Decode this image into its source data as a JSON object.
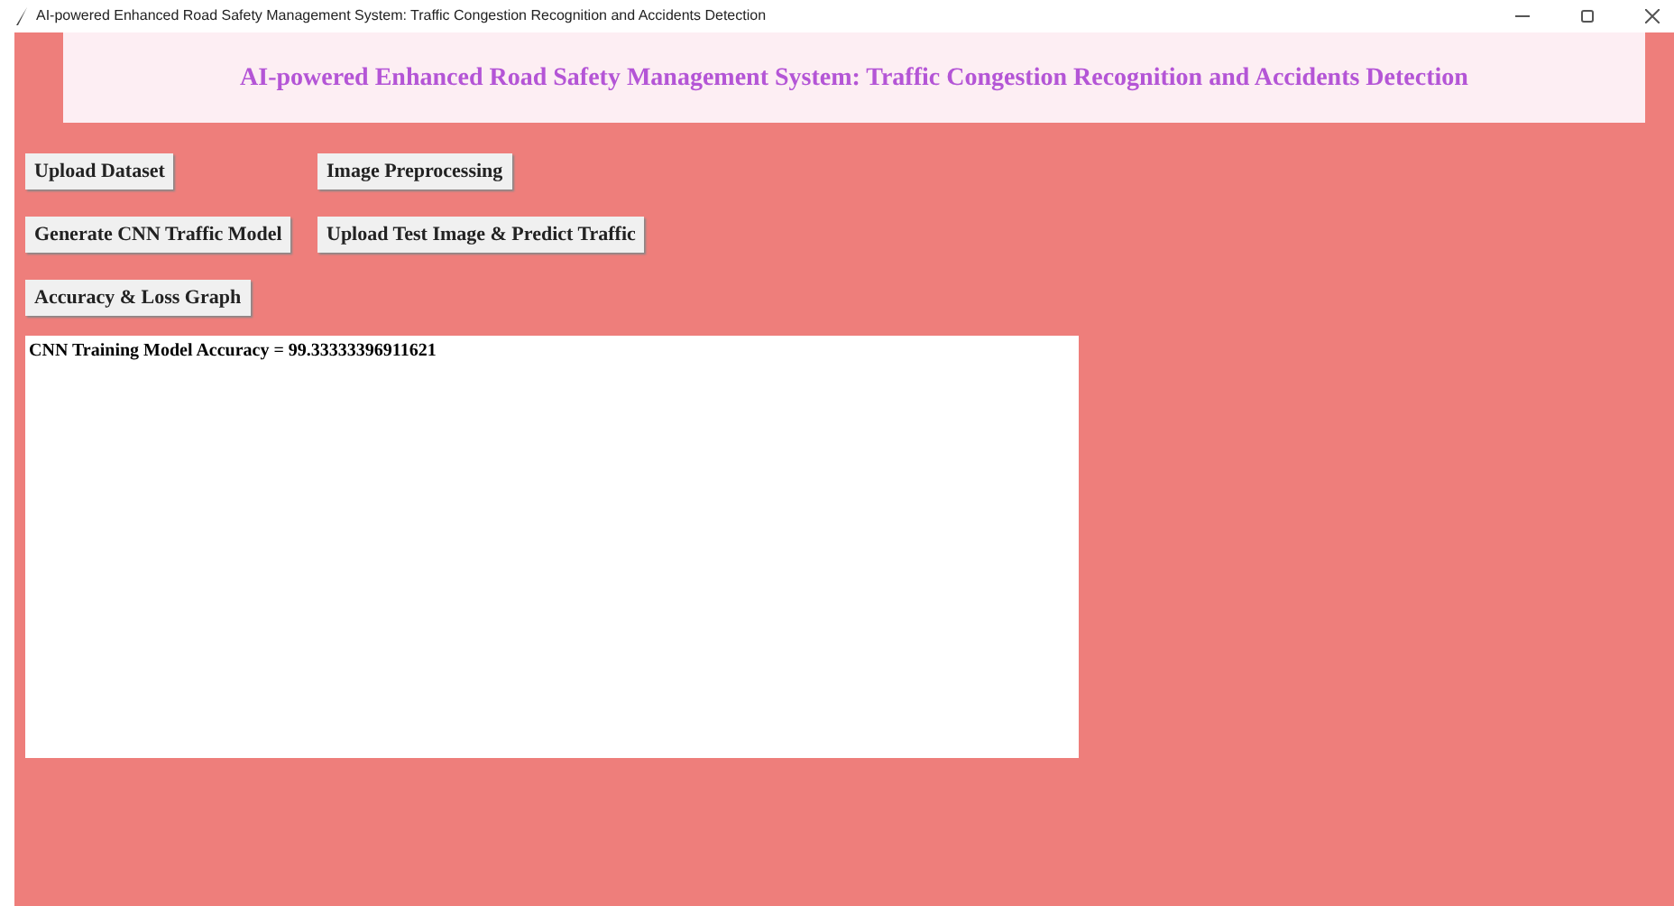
{
  "window": {
    "title": "AI-powered Enhanced Road Safety Management System: Traffic Congestion Recognition and Accidents Detection"
  },
  "header": {
    "title": "AI-powered Enhanced Road Safety Management System: Traffic Congestion Recognition and Accidents Detection"
  },
  "button_rows": [
    [
      "Upload Dataset",
      "Image Preprocessing"
    ],
    [
      "Generate CNN Traffic Model",
      "Upload Test Image & Predict Traffic"
    ],
    [
      "Accuracy & Loss Graph"
    ]
  ],
  "output": {
    "lines": [
      "CNN Training Model Accuracy = 99.33333396911621"
    ]
  }
}
